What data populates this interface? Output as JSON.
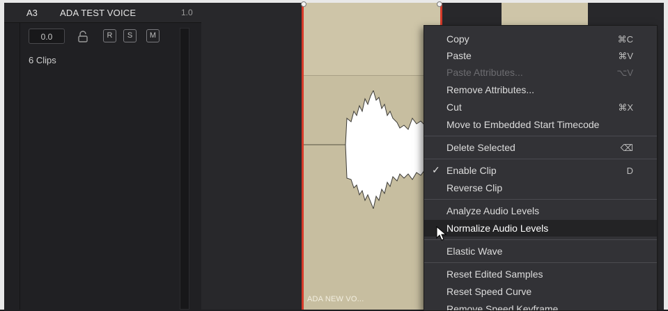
{
  "track": {
    "id": "A3",
    "name": "ADA TEST VOICE",
    "level": "1.0",
    "volume": "0.0",
    "buttons": [
      "R",
      "S",
      "M"
    ],
    "clips_count": "6 Clips"
  },
  "timeline": {
    "clip_label": "ADA NEW VO..."
  },
  "context_menu": {
    "items": [
      {
        "label": "Copy",
        "shortcut": "⌘C",
        "enabled": true
      },
      {
        "label": "Paste",
        "shortcut": "⌘V",
        "enabled": true
      },
      {
        "label": "Paste Attributes...",
        "shortcut": "⌥V",
        "enabled": false
      },
      {
        "label": "Remove Attributes...",
        "shortcut": "",
        "enabled": true
      },
      {
        "label": "Cut",
        "shortcut": "⌘X",
        "enabled": true
      },
      {
        "label": "Move to Embedded Start Timecode",
        "shortcut": "",
        "enabled": true
      },
      {
        "label": "Delete Selected",
        "shortcut": "⌫",
        "enabled": true
      },
      {
        "label": "Enable Clip",
        "shortcut": "D",
        "enabled": true,
        "checked": true
      },
      {
        "label": "Reverse Clip",
        "shortcut": "",
        "enabled": true
      },
      {
        "label": "Analyze Audio Levels",
        "shortcut": "",
        "enabled": true
      },
      {
        "label": "Normalize Audio Levels",
        "shortcut": "",
        "enabled": true,
        "highlighted": true
      },
      {
        "label": "Elastic Wave",
        "shortcut": "",
        "enabled": true
      },
      {
        "label": "Reset Edited Samples",
        "shortcut": "",
        "enabled": true
      },
      {
        "label": "Reset Speed Curve",
        "shortcut": "",
        "enabled": true
      },
      {
        "label": "Remove Speed Keyframe",
        "shortcut": "",
        "enabled": true
      }
    ]
  },
  "colors": {
    "clip": "#c7bea0",
    "clip_edge": "#d63a2a",
    "menu_bg": "#323236"
  }
}
